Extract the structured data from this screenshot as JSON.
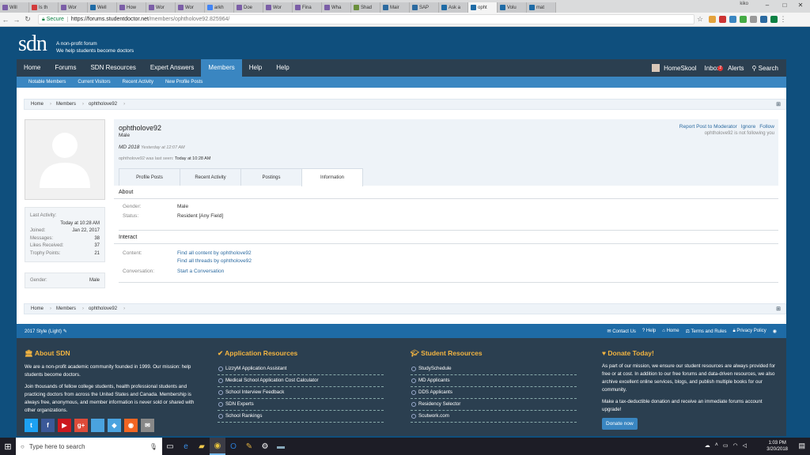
{
  "browser": {
    "tabs": [
      {
        "label": "Will",
        "color": "#7b5ea7"
      },
      {
        "label": "Is th",
        "color": "#d23b3b"
      },
      {
        "label": "Wor",
        "color": "#7b5ea7"
      },
      {
        "label": "Well",
        "color": "#1e6ba6"
      },
      {
        "label": "How",
        "color": "#7b5ea7"
      },
      {
        "label": "Wor",
        "color": "#7b5ea7"
      },
      {
        "label": "Wor",
        "color": "#7b5ea7"
      },
      {
        "label": "arkh",
        "color": "#4285f4"
      },
      {
        "label": "Doe",
        "color": "#7b5ea7"
      },
      {
        "label": "Wor",
        "color": "#7b5ea7"
      },
      {
        "label": "Fina",
        "color": "#7b5ea7"
      },
      {
        "label": "Wha",
        "color": "#7b5ea7"
      },
      {
        "label": "Shad",
        "color": "#6a8f3b"
      },
      {
        "label": "Mair",
        "color": "#2b6aa0"
      },
      {
        "label": "SAP",
        "color": "#2b6aa0"
      },
      {
        "label": "Ask a",
        "color": "#1e6ba6"
      },
      {
        "label": "opht",
        "color": "#1e6ba6",
        "active": true
      },
      {
        "label": "Volu",
        "color": "#1e6ba6"
      },
      {
        "label": "mat",
        "color": "#1e6ba6"
      }
    ],
    "user": "kiko",
    "window_minimize": "–",
    "window_maximize": "□",
    "window_close": "✕",
    "secure_label": "Secure",
    "url_host": "https://forums.studentdoctor.net",
    "url_path": "/members/ophtholove92.825964/"
  },
  "site": {
    "logo": "sdn",
    "tagline_1": "A non-profit forum",
    "tagline_2": "We help students become doctors"
  },
  "nav": {
    "items": [
      "Home",
      "Forums",
      "SDN Resources",
      "Expert Answers",
      "Members",
      "Help",
      "Help"
    ],
    "active_index": 4,
    "user": "HomeSkool",
    "inbox": "Inbox",
    "inbox_count": "2",
    "alerts": "Alerts",
    "search": "Search"
  },
  "subnav": [
    "Notable Members",
    "Current Visitors",
    "Recent Activity",
    "New Profile Posts"
  ],
  "breadcrumb": [
    "Home",
    "Members",
    "ophtholove92"
  ],
  "profile": {
    "username": "ophtholove92",
    "gender": "Male",
    "title": "MD 2018",
    "title_time": "Yesterday at 12:07 AM",
    "last_seen_prefix": "ophtholove92 was last seen:",
    "last_seen_time": "Today at 10:28 AM",
    "actions": [
      "Report Post to Moderator",
      "Ignore",
      "Follow"
    ],
    "follow_note": "ophtholove92 is not following you",
    "tabs": [
      "Profile Posts",
      "Recent Activity",
      "Postings",
      "Information"
    ],
    "active_tab": 3
  },
  "stats": {
    "last_activity_label": "Last Activity:",
    "last_activity_value": "Today at 10:28 AM",
    "rows": [
      {
        "label": "Joined:",
        "value": "Jan 22, 2017"
      },
      {
        "label": "Messages:",
        "value": "38"
      },
      {
        "label": "Likes Received:",
        "value": "37"
      },
      {
        "label": "Trophy Points:",
        "value": "21"
      }
    ],
    "gender_label": "Gender:",
    "gender_value": "Male"
  },
  "about": {
    "heading": "About",
    "gender_label": "Gender:",
    "gender_value": "Male",
    "status_label": "Status:",
    "status_value": "Resident [Any Field]"
  },
  "interact": {
    "heading": "Interact",
    "content_label": "Content:",
    "content_link_1": "Find all content by ophtholove92",
    "content_link_2": "Find all threads by ophtholove92",
    "conversation_label": "Conversation:",
    "conversation_link": "Start a Conversation"
  },
  "footer_strip": {
    "style": "2017 Style (Light)",
    "links": [
      "Contact Us",
      "Help",
      "Home",
      "Terms and Rules",
      "Privacy Policy"
    ]
  },
  "footer": {
    "about": {
      "heading": "About SDN",
      "p1": "We are a non-profit academic community founded in 1999. Our mission: help students become doctors.",
      "p2": "Join thousands of fellow college students, health professional students and practicing doctors from across the United States and Canada. Membership is always free, anonymous, and member information is never sold or shared with other organizations."
    },
    "app_resources": {
      "heading": "Application Resources",
      "items": [
        "LizzyM Application Assistant",
        "Medical School Application Cost Calculator",
        "School Interview Feedback",
        "SDN Experts",
        "School Rankings"
      ]
    },
    "student_resources": {
      "heading": "Student Resources",
      "items": [
        "StudySchedule",
        "MD Applicants",
        "DDS Applicants",
        "Residency Selector",
        "Scutwork.com"
      ]
    },
    "donate": {
      "heading": "Donate Today!",
      "p1": "As part of our mission, we ensure our student resources are always provided for free or at cost. In addition to our free forums and data-driven resources, we also archive excellent online services, blogs, and publish multiple books for our community.",
      "p2": "Make a tax-deductible donation and receive an immediate forums account upgrade!",
      "button": "Donate now"
    },
    "socials": [
      {
        "icon": "twitter-icon",
        "glyph": "t",
        "color": "#1da1f2"
      },
      {
        "icon": "facebook-icon",
        "glyph": "f",
        "color": "#3b5998"
      },
      {
        "icon": "youtube-icon",
        "glyph": "▶",
        "color": "#cc181e"
      },
      {
        "icon": "googleplus-icon",
        "glyph": "g+",
        "color": "#dd4b39"
      },
      {
        "icon": "apple-icon",
        "glyph": "",
        "color": "#4aa3df"
      },
      {
        "icon": "android-icon",
        "glyph": "◆",
        "color": "#4aa3df"
      },
      {
        "icon": "rss-icon",
        "glyph": "◉",
        "color": "#f26522"
      },
      {
        "icon": "email-icon",
        "glyph": "✉",
        "color": "#888888"
      }
    ]
  },
  "taskbar": {
    "search_placeholder": "Type here to search",
    "time": "1:03 PM",
    "date": "3/20/2018"
  }
}
